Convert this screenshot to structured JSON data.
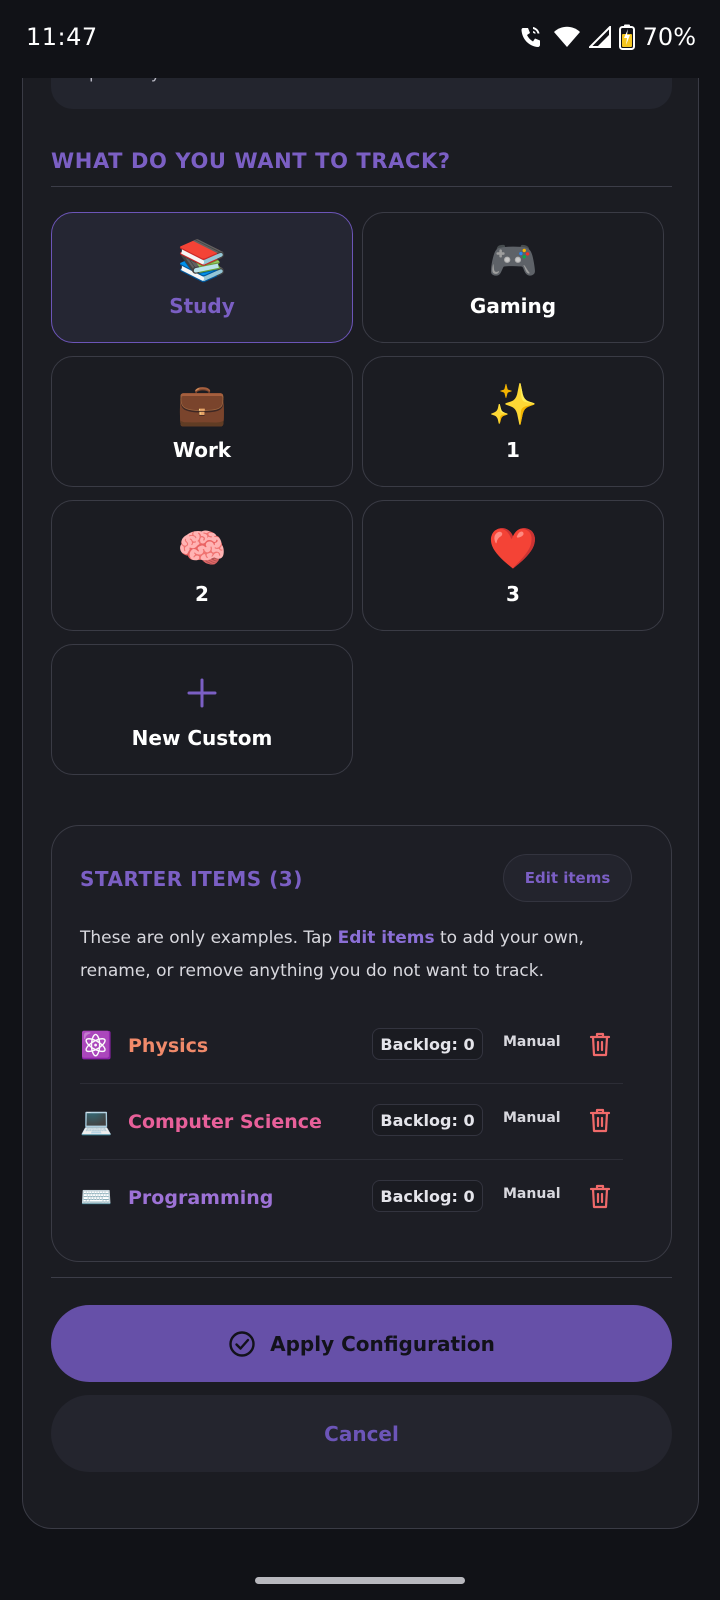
{
  "status_bar": {
    "time": "11:47",
    "battery": "70%",
    "icons": [
      "wifi-calling-icon",
      "wifi-icon",
      "signal-icon",
      "battery-charging-icon"
    ]
  },
  "top_card": {
    "text": "repeat-days schedules."
  },
  "track_section": {
    "title": "WHAT DO YOU WANT TO TRACK?",
    "categories": [
      {
        "emoji": "📚",
        "label": "Study",
        "selected": true
      },
      {
        "emoji": "🎮",
        "label": "Gaming",
        "selected": false
      },
      {
        "emoji": "💼",
        "label": "Work",
        "selected": false
      },
      {
        "emoji": "✨",
        "label": "1",
        "selected": false
      },
      {
        "emoji": "🧠",
        "label": "2",
        "selected": false
      },
      {
        "emoji": "❤️",
        "label": "3",
        "selected": false
      }
    ],
    "new_custom": {
      "icon": "plus-icon",
      "label": "New Custom"
    }
  },
  "starter": {
    "title": "STARTER ITEMS (3)",
    "edit_label": "Edit items",
    "desc_before": "These are only examples. Tap ",
    "desc_highlight": "Edit items",
    "desc_after": " to add your own, rename, or remove anything you do not want to track.",
    "items": [
      {
        "emoji": "⚛️",
        "name": "Physics",
        "color": "#f08a6a",
        "backlog": "Backlog: 0",
        "mode": "Manual"
      },
      {
        "emoji": "💻",
        "name": "Computer Science",
        "color": "#e8609a",
        "backlog": "Backlog: 0",
        "mode": "Manual"
      },
      {
        "emoji": "⌨️",
        "name": "Programming",
        "color": "#9d72d6",
        "backlog": "Backlog: 0",
        "mode": "Manual"
      }
    ]
  },
  "actions": {
    "apply_label": "Apply Configuration",
    "cancel_label": "Cancel"
  },
  "colors": {
    "accent": "#7b5fc4",
    "apply_bg": "#6650a8",
    "trash": "#f06a6a"
  }
}
